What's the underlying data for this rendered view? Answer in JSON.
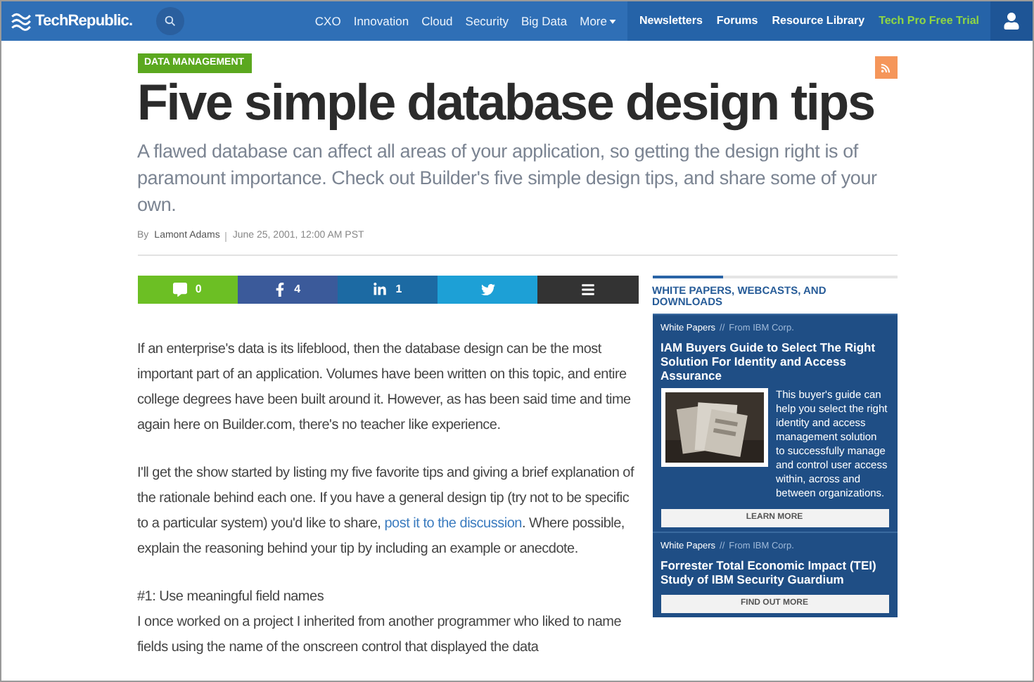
{
  "nav": {
    "logo": "TechRepublic.",
    "links": [
      {
        "label": "CXO",
        "dropdown": false
      },
      {
        "label": "Innovation",
        "dropdown": false
      },
      {
        "label": "Cloud",
        "dropdown": false
      },
      {
        "label": "Security",
        "dropdown": false
      },
      {
        "label": "Big Data",
        "dropdown": false
      },
      {
        "label": "More",
        "dropdown": true
      }
    ],
    "utility_links": [
      {
        "label": "Newsletters",
        "kind": "plain"
      },
      {
        "label": "Forums",
        "kind": "plain"
      },
      {
        "label": "Resource Library",
        "kind": "plain"
      },
      {
        "label": "Tech Pro Free Trial",
        "kind": "promo"
      }
    ]
  },
  "article": {
    "category": "DATA MANAGEMENT",
    "title": "Five simple database design tips",
    "dek": "A flawed database can affect all areas of your application, so getting the design right is of paramount importance. Check out Builder's five simple design tips, and share some of your own.",
    "byline": {
      "prefix": "By",
      "author": "Lamont Adams",
      "date": "June 25, 2001, 12:00 AM PST"
    },
    "share_bar": [
      {
        "kind": "comments",
        "count": "0"
      },
      {
        "kind": "facebook",
        "count": "4"
      },
      {
        "kind": "linkedin",
        "count": "1"
      },
      {
        "kind": "twitter"
      },
      {
        "kind": "more"
      }
    ],
    "body": [
      {
        "kind": "paragraph",
        "parts": [
          {
            "text": "If an enterprise's data is its lifeblood, then the database design can be the most important part of an application. Volumes have been written on this topic, and entire college degrees have been built around it. However, as has been said time and time again here on Builder.com, there's no teacher like experience."
          }
        ]
      },
      {
        "kind": "paragraph",
        "parts": [
          {
            "text": "I'll get the show started by listing my five favorite tips and giving a brief explanation of the rationale behind each one. If you have a general design tip (try not to be specific to a particular system) you'd like to share, "
          },
          {
            "link": "post it to the discussion"
          },
          {
            "text": ". Where possible, explain the reasoning behind your tip by including an example or anecdote."
          }
        ]
      },
      {
        "kind": "tip",
        "heading": "#1: Use meaningful field names",
        "text": "I once worked on a project I inherited from another programmer who liked to name fields using the name of the onscreen control that displayed the data"
      }
    ]
  },
  "sidebar": {
    "heading": "WHITE PAPERS, WEBCASTS, AND DOWNLOADS",
    "cards": [
      {
        "type": "White Papers",
        "separator": "//",
        "source": "From IBM Corp.",
        "title": "IAM Buyers Guide to Select The Right Solution For Identity and Access Assurance",
        "description": "This buyer's guide can help you select the right identity and access management solution to successfully manage and control user access within, across and between organizations.",
        "button": "LEARN MORE"
      },
      {
        "type": "White Papers",
        "separator": "//",
        "source": "From IBM Corp.",
        "title": "Forrester Total Economic Impact (TEI) Study of IBM Security Guardium",
        "button": "FIND OUT MORE"
      }
    ]
  }
}
